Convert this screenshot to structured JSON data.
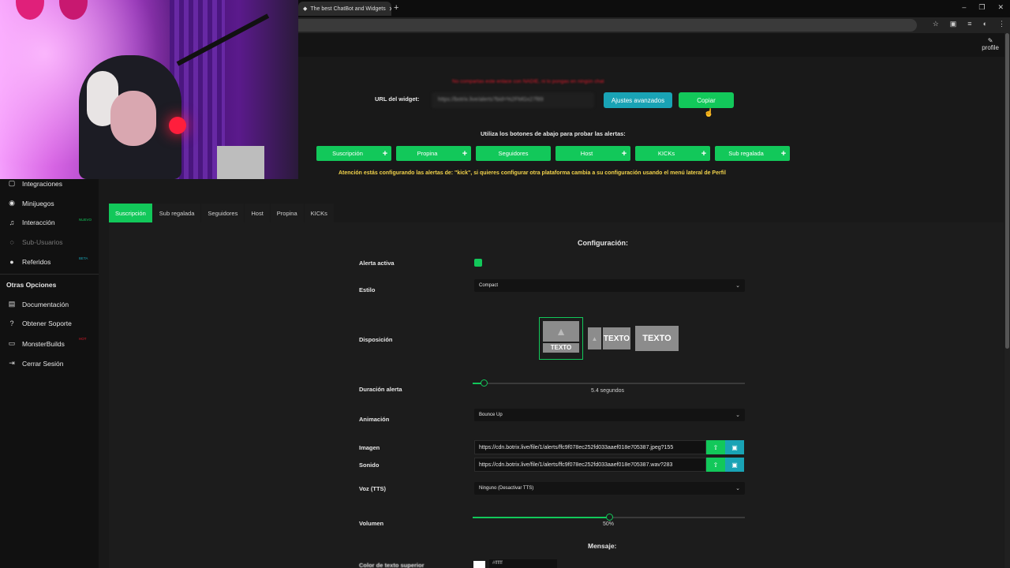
{
  "browser": {
    "tab_title": "The best ChatBot and Widgets",
    "new_tab": "+",
    "win_controls": [
      "–",
      "❐",
      "✕"
    ]
  },
  "header": {
    "profile_label": "profile"
  },
  "sidebar": {
    "items": [
      {
        "label": "Integraciones",
        "icon": "puzzle-icon",
        "glyph": "▢"
      },
      {
        "label": "Minijuegos",
        "icon": "gamepad-icon",
        "glyph": "◉"
      },
      {
        "label": "Interacción",
        "icon": "music-icon",
        "glyph": "♫",
        "badge": "NUEVO",
        "badge_color": "#12c85a"
      },
      {
        "label": "Sub-Usuarios",
        "icon": "users-icon",
        "glyph": "◌",
        "dim": true
      },
      {
        "label": "Referidos",
        "icon": "referral-icon",
        "glyph": "●",
        "badge": "BETA",
        "badge_color": "#19a3b5"
      }
    ],
    "other_heading": "Otras Opciones",
    "other_items": [
      {
        "label": "Documentación",
        "icon": "document-icon",
        "glyph": "▤"
      },
      {
        "label": "Obtener Soporte",
        "icon": "question-icon",
        "glyph": "?"
      },
      {
        "label": "MonsterBuilds",
        "icon": "monitor-icon",
        "glyph": "▭",
        "badge": "HOT",
        "badge_color": "#e01a2b"
      },
      {
        "label": "Cerrar Sesión",
        "icon": "logout-icon",
        "glyph": "⇥"
      }
    ]
  },
  "widget": {
    "warning": "No compartas este enlace con NADIE, ni lo pongas en ningún chat",
    "url_label": "URL del widget:",
    "url_value": "https://botrix.live/alerts?bid=%2FMGx27f89",
    "advanced_button": "Ajustes avanzados",
    "copy_button": "Copiar",
    "test_title": "Utiliza los botones de abajo para probar las alertas:",
    "test_buttons": [
      "Suscripción",
      "Propina",
      "Seguidores",
      "Host",
      "KICKs",
      "Sub regalada"
    ],
    "test_plus": "+",
    "attention": "Atención estás configurando las alertas de: \"kick\", si quieres configurar otra plataforma cambia a su configuración usando el menú lateral de Perfil"
  },
  "tabs": [
    "Suscripción",
    "Sub regalada",
    "Seguidores",
    "Host",
    "Propina",
    "KICKs"
  ],
  "active_tab": 0,
  "config": {
    "title": "Configuración:",
    "alert_active_label": "Alerta activa",
    "alert_active": true,
    "style_label": "Estilo",
    "style_value": "Compact",
    "layout_label": "Disposición",
    "layout_text": "TEXTO",
    "duration_label": "Duración alerta",
    "duration_value": "5.4 segundos",
    "duration_fraction": 0.04,
    "animation_label": "Animación",
    "animation_value": "Bounce Up",
    "image_label": "Imagen",
    "image_value": "https://cdn.botrix.live/file/1/alerts/ffc9f078ec252fd033aaef018e705387.jpeg?155",
    "sound_label": "Sonido",
    "sound_value": "https://cdn.botrix.live/file/1/alerts/ffc9f078ec252fd033aaef018e705387.wav?283",
    "tts_label": "Voz (TTS)",
    "tts_value": "Ninguno (Desactivar TTS)",
    "volume_label": "Volumen",
    "volume_value": "50%",
    "volume_fraction": 0.5,
    "message_title": "Mensaje:",
    "top_text_color_label": "Color de texto superior",
    "top_text_color_value": "#ffffff"
  }
}
